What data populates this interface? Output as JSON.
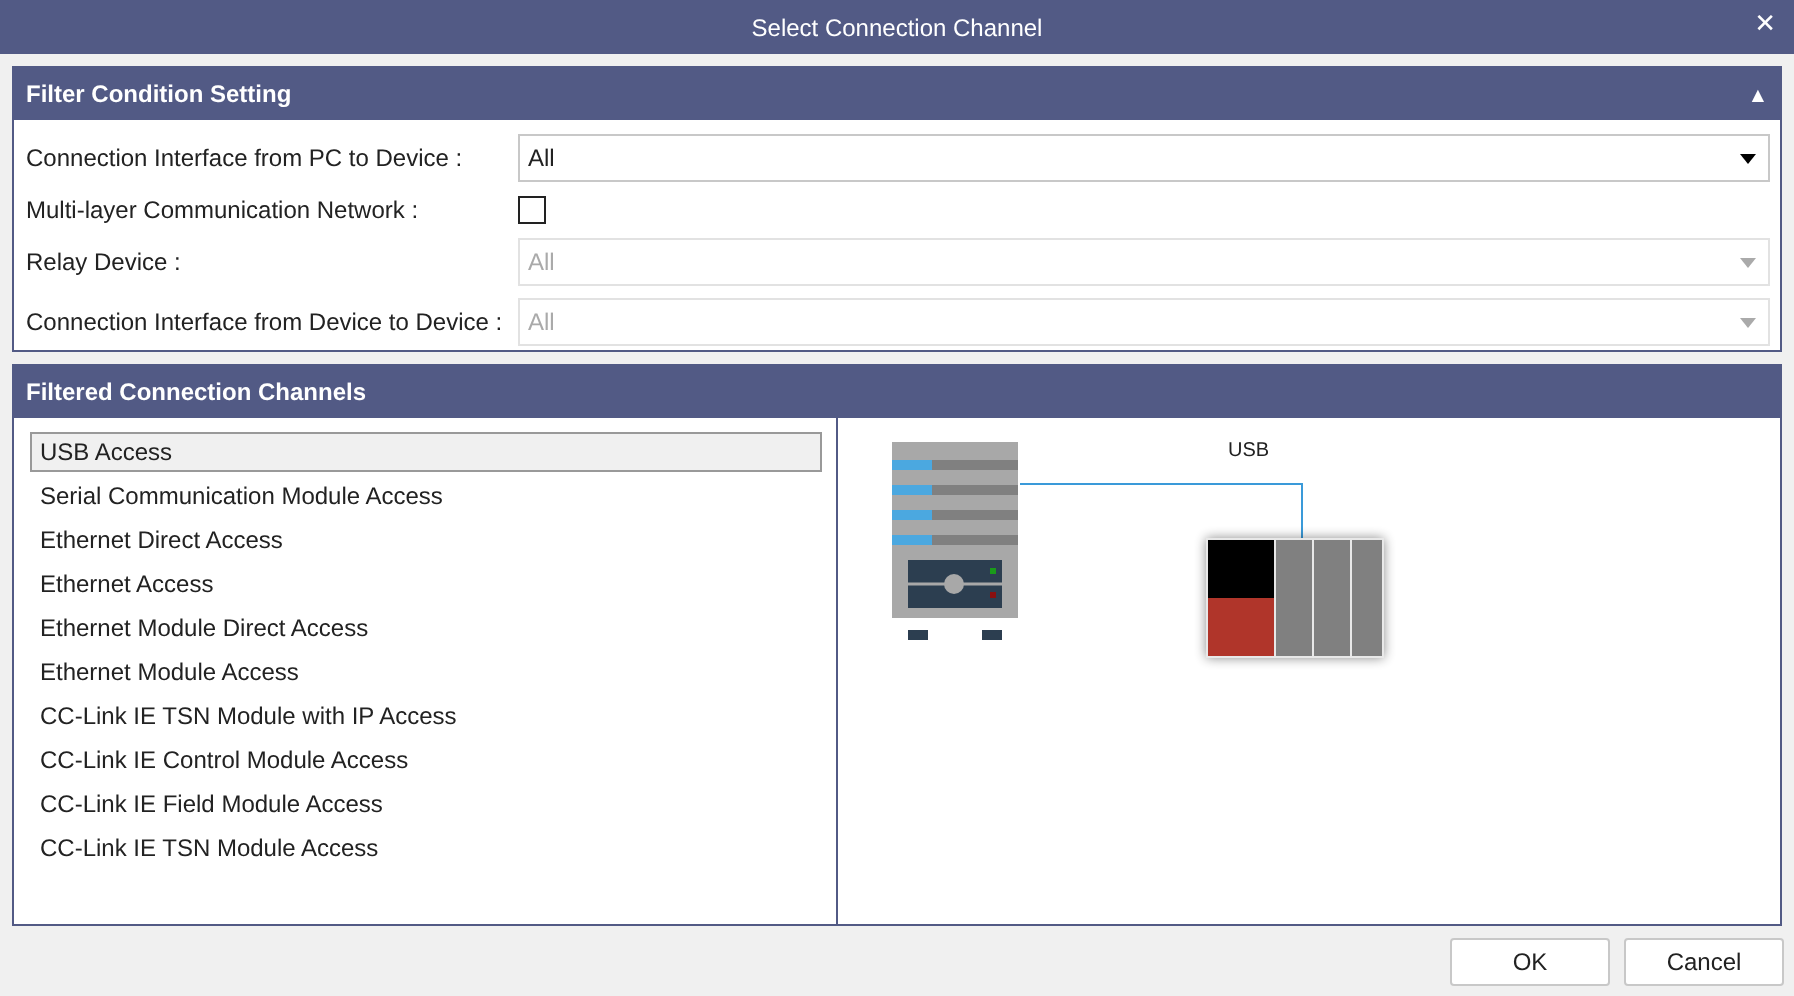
{
  "window": {
    "title": "Select Connection Channel",
    "close": "✕"
  },
  "filter_panel": {
    "title": "Filter Condition Setting",
    "collapse": "▲",
    "expanded": true,
    "fields": [
      {
        "kind": "select",
        "label": "Connection Interface from PC to Device :",
        "value": "All",
        "disabled": false
      },
      {
        "kind": "checkbox",
        "label": "Multi-layer Communication Network :",
        "checked": false
      },
      {
        "kind": "select",
        "label": "Relay Device :",
        "value": "All",
        "disabled": true
      },
      {
        "kind": "select",
        "label": "Connection Interface from Device to Device :",
        "value": "All",
        "disabled": true
      }
    ]
  },
  "channels_panel": {
    "title": "Filtered Connection Channels",
    "items": [
      {
        "label": "USB Access",
        "selected": true
      },
      {
        "label": "Serial Communication Module Access",
        "selected": false
      },
      {
        "label": "Ethernet Direct Access",
        "selected": false
      },
      {
        "label": "Ethernet Access",
        "selected": false
      },
      {
        "label": "Ethernet Module Direct Access",
        "selected": false
      },
      {
        "label": "Ethernet Module Access",
        "selected": false
      },
      {
        "label": "CC-Link IE TSN Module with IP Access",
        "selected": false
      },
      {
        "label": "CC-Link IE Control Module Access",
        "selected": false
      },
      {
        "label": "CC-Link IE Field Module Access",
        "selected": false
      },
      {
        "label": "CC-Link IE TSN Module Access",
        "selected": false
      }
    ],
    "diagram": {
      "connection_label": "USB"
    }
  },
  "buttons": [
    "OK",
    "Cancel"
  ]
}
